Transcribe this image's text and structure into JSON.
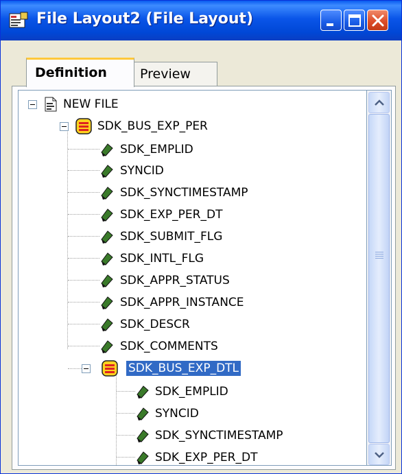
{
  "window": {
    "title": "File Layout2 (File Layout)"
  },
  "tabs": [
    {
      "label": "Definition",
      "active": true
    },
    {
      "label": "Preview",
      "active": false
    }
  ],
  "tree": {
    "root": "NEW FILE",
    "records": [
      {
        "name": "SDK_BUS_EXP_PER",
        "selected": false,
        "fields": [
          "SDK_EMPLID",
          "SYNCID",
          "SDK_SYNCTIMESTAMP",
          "SDK_EXP_PER_DT",
          "SDK_SUBMIT_FLG",
          "SDK_INTL_FLG",
          "SDK_APPR_STATUS",
          "SDK_APPR_INSTANCE",
          "SDK_DESCR",
          "SDK_COMMENTS"
        ]
      },
      {
        "name": "SDK_BUS_EXP_DTL",
        "selected": true,
        "fields": [
          "SDK_EMPLID",
          "SYNCID",
          "SDK_SYNCTIMESTAMP",
          "SDK_EXP_PER_DT"
        ]
      }
    ]
  },
  "colors": {
    "titlebar": "#0a55e8",
    "selection": "#316ac5",
    "field_icon": "#3a7a2a",
    "record_icon": "#ffd21e"
  },
  "icons": {
    "window": "file-layout-icon",
    "root": "file-icon",
    "record": "record-icon",
    "field": "field-icon"
  }
}
